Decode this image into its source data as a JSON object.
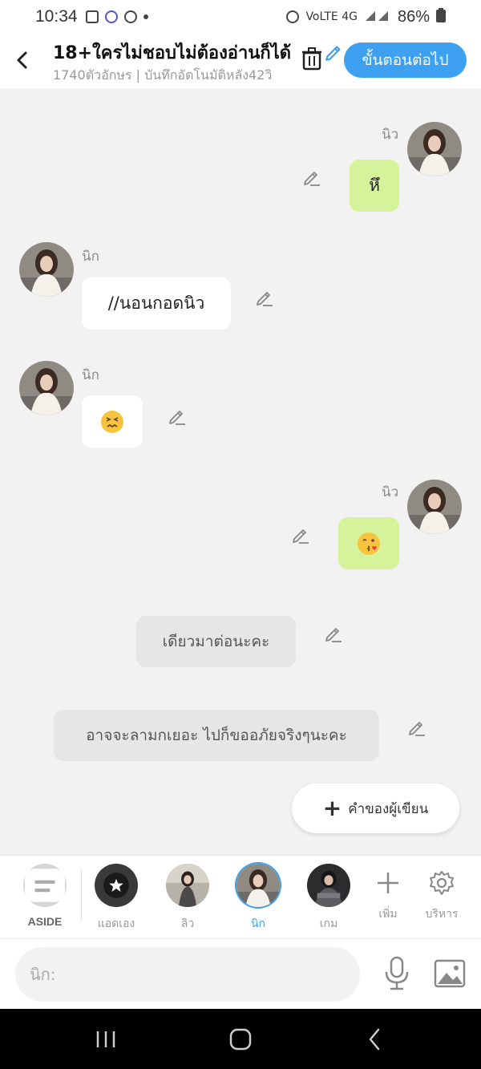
{
  "status": {
    "time": "10:34",
    "network": "VoLTE 4G",
    "battery": "86%"
  },
  "header": {
    "title": "18+ใครไม่ชอบไม่ต้องอ่านก็ได้",
    "subtitle": "1740ตัวอักษร | บันทึกอัตโนมัติหลัง42วิ",
    "next_label": "ขั้นตอนต่อไป"
  },
  "messages": [
    {
      "speaker": "นิว",
      "text": "หึ",
      "side": "right",
      "style": "green"
    },
    {
      "speaker": "นิก",
      "text": "//นอนกอดนิว",
      "side": "left",
      "style": "white"
    },
    {
      "speaker": "นิก",
      "emoji": "confounded-face",
      "side": "left",
      "style": "white"
    },
    {
      "speaker": "นิว",
      "emoji": "face-blowing-kiss",
      "side": "right",
      "style": "green"
    },
    {
      "text": "เดียวมาต่อนะคะ",
      "style": "aside"
    },
    {
      "text": "อาจจะลามกเยอะ ไปก็ขออภัยจริงๆนะคะ",
      "style": "aside"
    }
  ],
  "fab": {
    "label": "คำของผู้เขียน",
    "icon": "plus-icon"
  },
  "characters": [
    {
      "label": "ASIDE",
      "icon": "aside-bubble-icon"
    },
    {
      "label": "แอดเอง"
    },
    {
      "label": "ลิว"
    },
    {
      "label": "นิก",
      "active": true
    },
    {
      "label": "เกม"
    }
  ],
  "tools": {
    "add_label": "เพิ่ม",
    "manage_label": "บริหาร"
  },
  "input": {
    "placeholder": "นิก:"
  },
  "colors": {
    "accent": "#3ea0f0",
    "green_bubble": "#d5f39a",
    "aside_bubble": "#e6e6e6",
    "background": "#f2f2f2"
  }
}
